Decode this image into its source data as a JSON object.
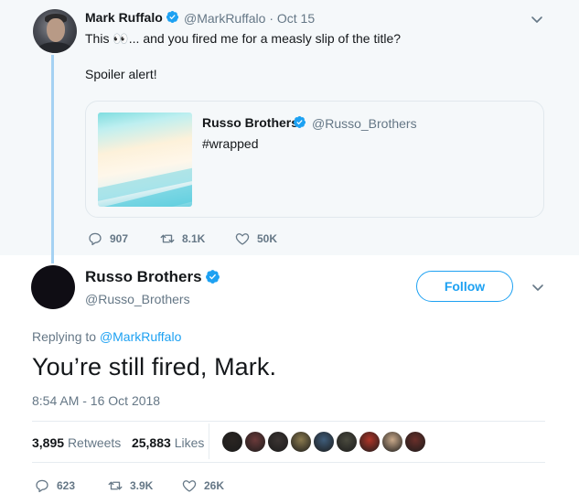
{
  "parent_tweet": {
    "author_name": "Mark Ruffalo",
    "handle_and_date": "@MarkRuffalo · Oct 15",
    "text_line1": "This 👀... and you fired me for a measly slip of the title?",
    "text_line2": "Spoiler alert!",
    "quoted": {
      "author_name": "Russo Brothers",
      "handle": "@Russo_Brothers",
      "text": "#wrapped"
    },
    "actions": {
      "replies": "907",
      "retweets": "8.1K",
      "likes": "50K"
    }
  },
  "main_tweet": {
    "author_name": "Russo Brothers",
    "handle": "@Russo_Brothers",
    "follow_label": "Follow",
    "replying_prefix": "Replying to",
    "replying_to": "@MarkRuffalo",
    "text": "You’re still fired, Mark.",
    "timestamp": "8:54 AM - 16 Oct 2018",
    "retweet_count": "3,895",
    "retweet_label": "Retweets",
    "like_count": "25,883",
    "like_label": "Likes",
    "actions": {
      "replies": "623",
      "retweets": "3.9K",
      "likes": "26K"
    }
  },
  "colors": {
    "accent": "#1da1f2",
    "muted": "#657786",
    "thread_line": "#a5d2f3",
    "parent_bg": "#f5f8fa"
  },
  "likers": [
    {
      "color": "#2a2522"
    },
    {
      "color": "#6b3a3a"
    },
    {
      "color": "#3b3432"
    },
    {
      "color": "#8a7a4e"
    },
    {
      "color": "#3f5d7a"
    },
    {
      "color": "#4a4a3e"
    },
    {
      "color": "#b03528"
    },
    {
      "color": "#c9a98a"
    },
    {
      "color": "#6a2f2a"
    }
  ]
}
